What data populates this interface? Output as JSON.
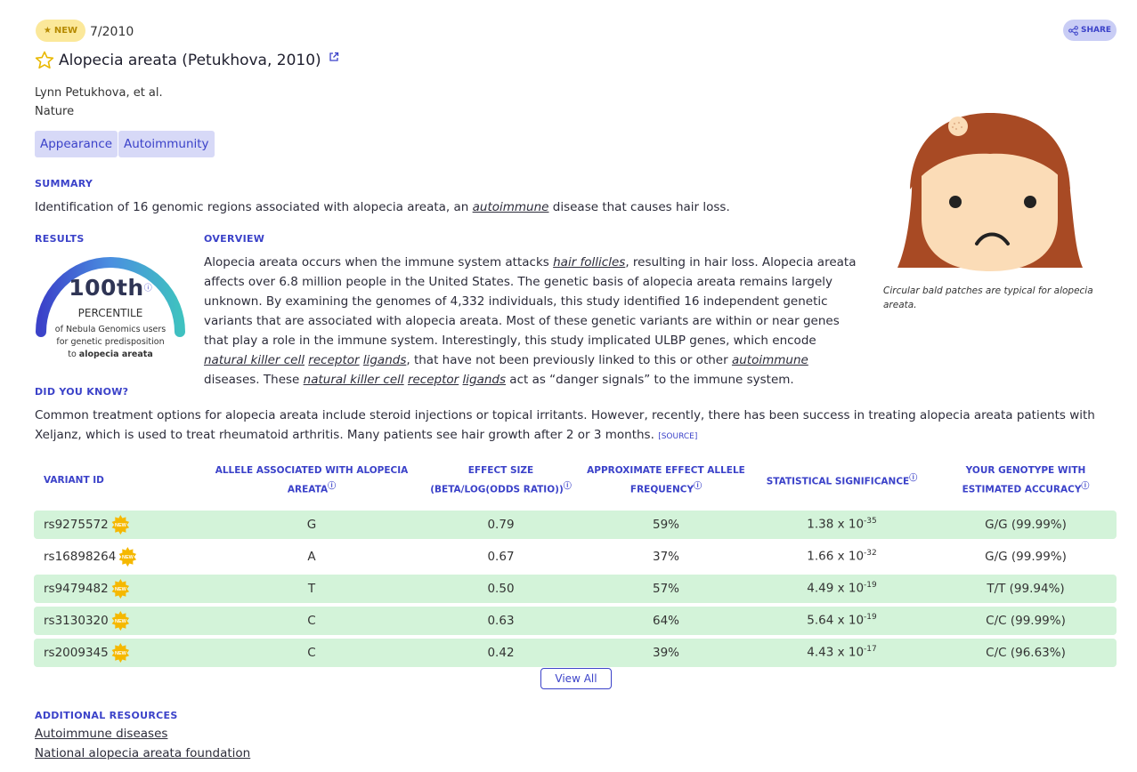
{
  "header": {
    "badge": "NEW",
    "date": "7/2010",
    "share": "SHARE",
    "title": "Alopecia areata (Petukhova, 2010)",
    "authors": "Lynn Petukhova, et al.",
    "journal": "Nature",
    "tags": [
      "Appearance",
      "Autoimmunity"
    ]
  },
  "summary": {
    "heading": "SUMMARY",
    "text_before": "Identification of 16 genomic regions associated with alopecia areata, an ",
    "link": "autoimmune",
    "text_after": " disease that causes hair loss."
  },
  "results": {
    "heading": "RESULTS",
    "value": "100th",
    "unit": "PERCENTILE",
    "line1": "of Nebula Genomics users",
    "line2": "for genetic predisposition",
    "line3_prefix": "to ",
    "line3_bold": "alopecia areata",
    "percentile": 100
  },
  "overview": {
    "heading": "OVERVIEW",
    "p1": "Alopecia areata occurs when the immune system attacks ",
    "l1": "hair follicles",
    "p2": ", resulting in hair loss. Alopecia areata affects over 6.8 million people in the United States. The genetic basis of alopecia areata remains largely unknown. By examining the genomes of 4,332 individuals, this study identified 16 independent genetic variants that are associated with alopecia areata. Most of these genetic variants are within or near genes that play a role in the immune system. Interestingly, this study implicated ULBP genes, which encode ",
    "l2": "natural killer cell",
    "l3": "receptor",
    "l4": "ligands",
    "p3": ", that have not been previously linked to this or other ",
    "l5": "autoimmune",
    "p4": " diseases. These ",
    "l6": "natural killer cell",
    "l7": "receptor",
    "l8": "ligands",
    "p5": " act as “danger signals” to the immune system."
  },
  "illustration": {
    "caption": "Circular bald patches are typical for alopecia areata."
  },
  "did_you_know": {
    "heading": "DID YOU KNOW?",
    "text": "Common treatment options for alopecia areata include steroid injections or topical irritants. However, recently, there has been success in treating alopecia areata patients with Xeljanz, which is used to treat rheumatoid arthritis. Many patients see hair growth after 2 or 3 months.",
    "source": "[SOURCE]"
  },
  "table": {
    "headers": {
      "c1": "VARIANT ID",
      "c2": "ALLELE ASSOCIATED WITH ALOPECIA AREATA",
      "c3a": "EFFECT SIZE",
      "c3b": "(BETA/LOG(ODDS RATIO))",
      "c4": "APPROXIMATE EFFECT ALLELE FREQUENCY",
      "c5": "STATISTICAL SIGNIFICANCE",
      "c6": "YOUR GENOTYPE WITH ESTIMATED ACCURACY"
    },
    "new_label": "NEW",
    "sig_base": " x 10",
    "rows": [
      {
        "id": "rs9275572",
        "allele": "G",
        "effect": "0.79",
        "freq": "59%",
        "sig_mant": "1.38",
        "sig_exp": "-35",
        "genotype": "G/G (99.99%)"
      },
      {
        "id": "rs16898264",
        "allele": "A",
        "effect": "0.67",
        "freq": "37%",
        "sig_mant": "1.66",
        "sig_exp": "-32",
        "genotype": "G/G (99.99%)"
      },
      {
        "id": "rs9479482",
        "allele": "T",
        "effect": "0.50",
        "freq": "57%",
        "sig_mant": "4.49",
        "sig_exp": "-19",
        "genotype": "T/T (99.94%)"
      },
      {
        "id": "rs3130320",
        "allele": "C",
        "effect": "0.63",
        "freq": "64%",
        "sig_mant": "5.64",
        "sig_exp": "-19",
        "genotype": "C/C (99.99%)"
      },
      {
        "id": "rs2009345",
        "allele": "C",
        "effect": "0.42",
        "freq": "39%",
        "sig_mant": "4.43",
        "sig_exp": "-17",
        "genotype": "C/C (96.63%)"
      }
    ],
    "view_all": "View All"
  },
  "resources": {
    "heading": "ADDITIONAL RESOURCES",
    "links": [
      "Autoimmune diseases",
      "National alopecia areata foundation"
    ]
  },
  "colors": {
    "accent": "#3b42c9",
    "tag_bg": "#d7d9f7",
    "row_shade": "#d3f3d9",
    "badge_bg": "#fbe89a",
    "new_burst": "#f5b800"
  }
}
